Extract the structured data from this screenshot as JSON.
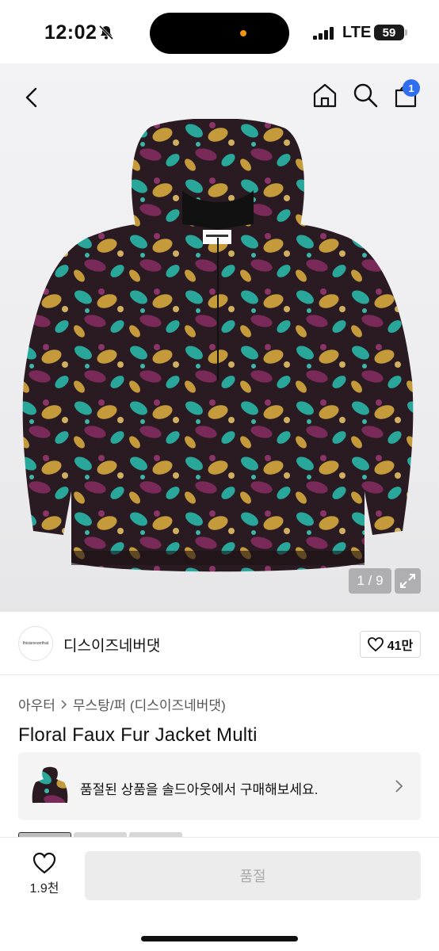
{
  "status_bar": {
    "time": "12:02",
    "network": "LTE",
    "battery": "59"
  },
  "top_nav": {
    "cart_badge": "1"
  },
  "gallery": {
    "page_indicator": "1 / 9"
  },
  "shop": {
    "logo_text": "thisisneverthat",
    "name": "디스이즈네버댓",
    "like_count": "41만"
  },
  "product": {
    "breadcrumb": [
      "아우터",
      "무스탕/퍼 (디스이즈네버댓)"
    ],
    "title": "Floral Faux Fur Jacket Multi"
  },
  "soldout_banner": {
    "text": "품절된 상품을 솔드아웃에서 구매해보세요."
  },
  "bottom_bar": {
    "wish_count": "1.9천",
    "main_button": "품절"
  },
  "colors": {
    "badge_blue": "#2f6fed",
    "island_dot": "#f2950c"
  }
}
